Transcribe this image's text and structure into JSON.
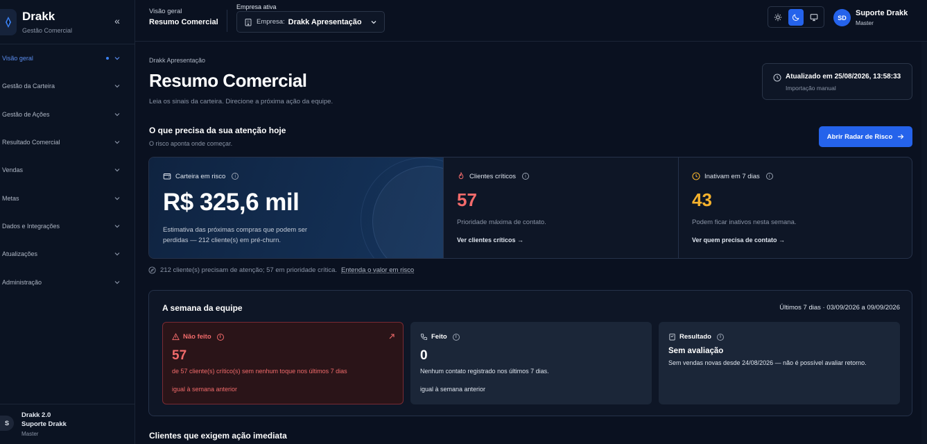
{
  "brand": {
    "name": "Drakk",
    "subtitle": "Gestão Comercial"
  },
  "sidebar": {
    "items": [
      {
        "label": "Visão geral",
        "active": true
      },
      {
        "label": "Gestão da Carteira"
      },
      {
        "label": "Gestão de Ações"
      },
      {
        "label": "Resultado Comercial"
      },
      {
        "label": "Vendas"
      },
      {
        "label": "Metas"
      },
      {
        "label": "Dados e Integrações"
      },
      {
        "label": "Atualizações"
      },
      {
        "label": "Administração"
      }
    ],
    "footer": {
      "avatar": "S",
      "app": "Drakk 2.0",
      "user": "Suporte Drakk",
      "role": "Master"
    }
  },
  "header": {
    "crumb": "Visão geral",
    "title": "Resumo Comercial",
    "company_label": "Empresa ativa",
    "company_prefix": "Empresa:",
    "company_value": "Drakk Apresentação",
    "user_initials": "SD",
    "user_name": "Suporte Drakk",
    "user_role": "Master"
  },
  "page": {
    "crumb": "Drakk Apresentação",
    "title": "Resumo Comercial",
    "subtitle": "Leia os sinais da carteira. Direcione a próxima ação da equipe.",
    "updated_title": "Atualizado em 25/08/2026, 13:58:33",
    "updated_sub": "Importação manual"
  },
  "attention": {
    "title": "O que precisa da sua atenção hoje",
    "subtitle": "O risco aponta onde começar.",
    "radar_button": "Abrir Radar de Risco",
    "note": "212 cliente(s) precisam de atenção; 57 em prioridade crítica.",
    "note_link": "Entenda o valor em risco"
  },
  "kpis": {
    "risk": {
      "label": "Carteira em risco",
      "value": "R$ 325,6 mil",
      "desc": "Estimativa das próximas compras que podem ser perdidas — 212 cliente(s) em pré-churn."
    },
    "critical": {
      "label": "Clientes críticos",
      "value": "57",
      "desc": "Prioridade máxima de contato.",
      "link": "Ver clientes críticos →",
      "color": "#f26b6b"
    },
    "inactive": {
      "label": "Inativam em 7 dias",
      "value": "43",
      "desc": "Podem ficar inativos nesta semana.",
      "link": "Ver quem precisa de contato →",
      "color": "#f5b22d"
    }
  },
  "week": {
    "title": "A semana da equipe",
    "range": "Últimos 7 dias · 03/09/2026 a 09/09/2026",
    "not_done": {
      "label": "Não feito",
      "value": "57",
      "desc": "de 57 cliente(s) crítico(s) sem nenhum toque nos últimos 7 dias",
      "compare": "igual à semana anterior"
    },
    "done": {
      "label": "Feito",
      "value": "0",
      "desc": "Nenhum contato registrado nos últimos 7 dias.",
      "compare": "igual à semana anterior"
    },
    "result": {
      "label": "Resultado",
      "heading": "Sem avaliação",
      "desc": "Sem vendas novas desde 24/08/2026 — não é possível avaliar retorno."
    }
  },
  "bottom": {
    "title": "Clientes que exigem ação imediata"
  },
  "colors": {
    "accent": "#2563eb",
    "danger": "#f26b6b",
    "warning": "#f5b22d",
    "background": "#0a1120"
  },
  "icons": [
    "drakk-logo-icon",
    "double-chevron-left-icon",
    "chevron-down-icon",
    "building-icon",
    "sun-icon",
    "moon-icon",
    "monitor-icon",
    "clock-icon",
    "arrow-right-icon",
    "wallet-icon",
    "flame-icon",
    "info-icon",
    "compass-icon",
    "warning-triangle-icon",
    "phone-icon",
    "external-arrow-icon",
    "receipt-icon"
  ]
}
